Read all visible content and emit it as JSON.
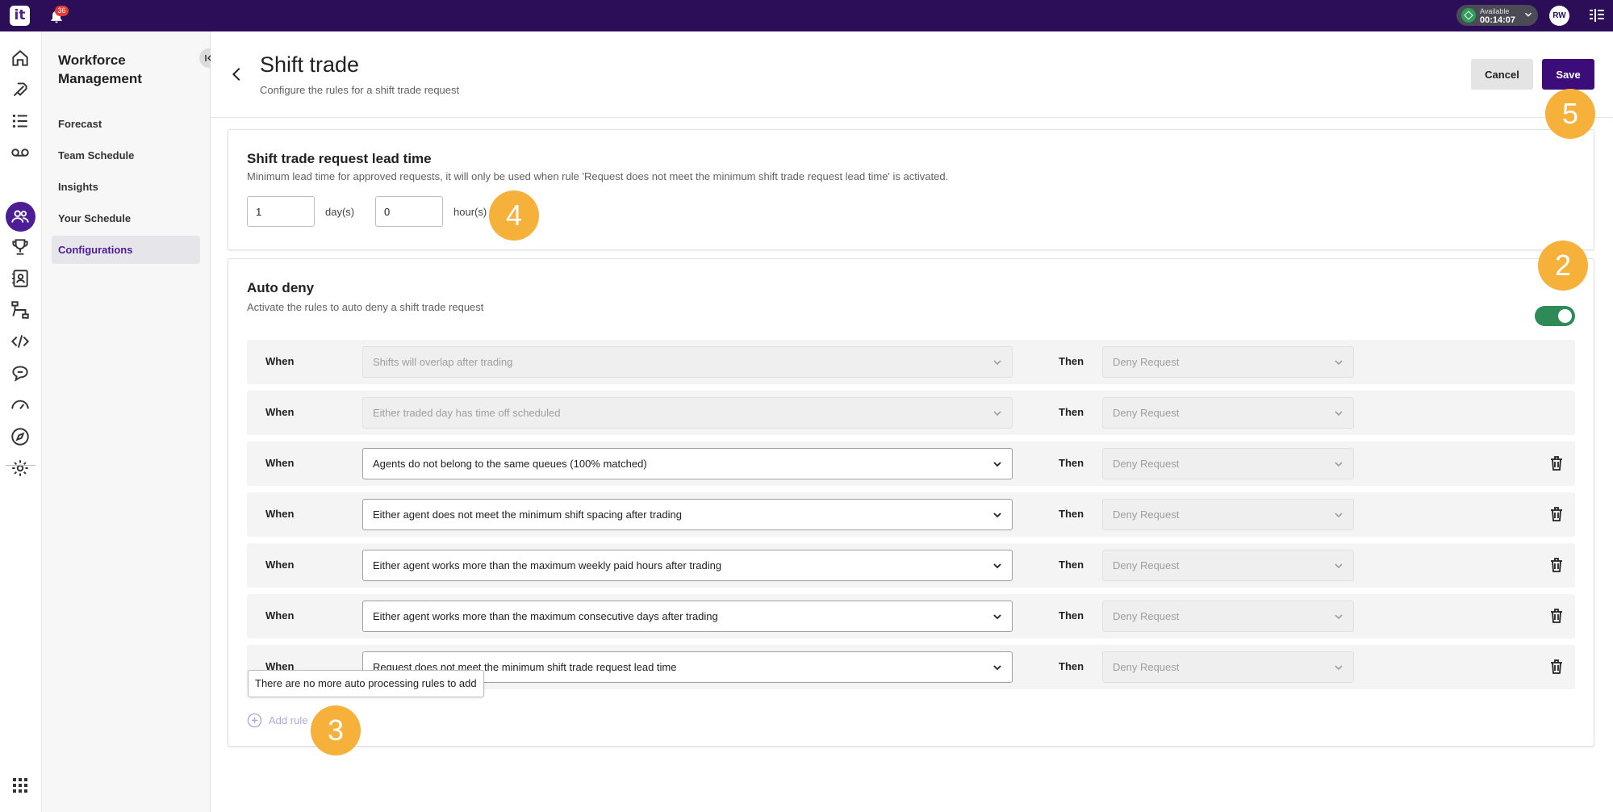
{
  "topbar": {
    "logo_text": "it",
    "notification_count": "36",
    "status": {
      "label": "Available",
      "time": "00:14:07",
      "color": "#2e9e5a"
    },
    "avatar_initials": "RW"
  },
  "rail": {
    "icons": [
      "home-icon",
      "routing-icon",
      "list-icon",
      "voicemail-icon",
      "workforce-icon",
      "trophy-icon",
      "contacts-icon",
      "flow-icon",
      "code-icon",
      "chat-icon",
      "dashboard-icon",
      "compass-icon",
      "settings-icon"
    ],
    "active_icon": "workforce-icon",
    "bottom_icon": "apps-grid-icon"
  },
  "sidenav": {
    "title": "Workforce Management",
    "items": [
      {
        "label": "Forecast",
        "active": false
      },
      {
        "label": "Team Schedule",
        "active": false
      },
      {
        "label": "Insights",
        "active": false
      },
      {
        "label": "Your Schedule",
        "active": false
      },
      {
        "label": "Configurations",
        "active": true
      }
    ]
  },
  "header": {
    "title": "Shift trade",
    "subtitle": "Configure the rules for a shift trade request",
    "cancel_label": "Cancel",
    "save_label": "Save"
  },
  "lead_time": {
    "title": "Shift trade request lead time",
    "description": "Minimum lead time for approved requests, it will only be used when rule 'Request does not meet the minimum shift trade request lead time' is activated.",
    "days_value": "1",
    "days_unit": "day(s)",
    "hours_value": "0",
    "hours_unit": "hour(s)"
  },
  "auto_deny": {
    "title": "Auto deny",
    "description": "Activate the rules to auto deny a shift trade request",
    "enabled": true,
    "toggle_color": "#2e8b57",
    "when_label": "When",
    "then_label": "Then",
    "rules": [
      {
        "condition": "Shifts will overlap after trading",
        "action": "Deny Request",
        "editable": false,
        "deletable": false
      },
      {
        "condition": "Either traded day has time off scheduled",
        "action": "Deny Request",
        "editable": false,
        "deletable": false
      },
      {
        "condition": "Agents do not belong to the same queues (100% matched)",
        "action": "Deny Request",
        "editable": true,
        "deletable": true
      },
      {
        "condition": "Either agent does not meet the minimum shift spacing after trading",
        "action": "Deny Request",
        "editable": true,
        "deletable": true
      },
      {
        "condition": "Either agent works more than the maximum weekly paid hours after trading",
        "action": "Deny Request",
        "editable": true,
        "deletable": true
      },
      {
        "condition": "Either agent works more than the maximum consecutive days after trading",
        "action": "Deny Request",
        "editable": true,
        "deletable": true
      },
      {
        "condition": "Request does not meet the minimum shift trade request lead time",
        "action": "Deny Request",
        "editable": true,
        "deletable": true
      }
    ],
    "tooltip": "There are no more auto processing rules to add",
    "add_rule_label": "Add rule"
  },
  "callouts": [
    "2",
    "3",
    "4",
    "5"
  ],
  "colors": {
    "topbar": "#2b0e57",
    "accent": "#4c1d95",
    "save_button": "#3c0d7a",
    "callout": "#f6b13a"
  }
}
